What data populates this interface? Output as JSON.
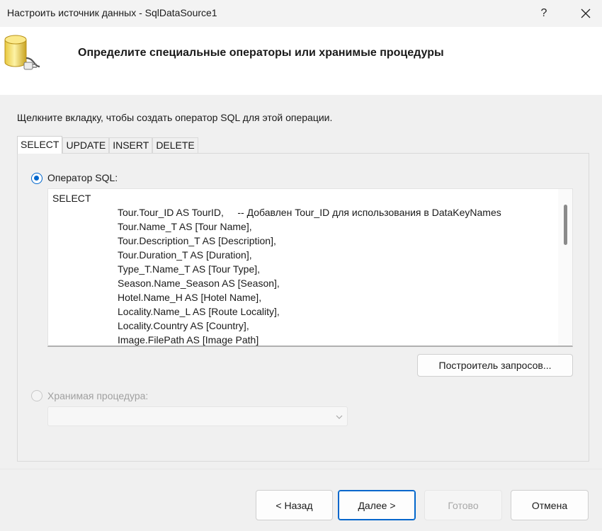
{
  "window": {
    "title": "Настроить источник данных - SqlDataSource1",
    "help_label": "?"
  },
  "header": {
    "title": "Определите специальные операторы или хранимые процедуры",
    "icon": "database-connect-icon"
  },
  "instruction": "Щелкните вкладку, чтобы создать оператор SQL для этой операции.",
  "tabs": [
    {
      "label": "SELECT",
      "active": true
    },
    {
      "label": "UPDATE",
      "active": false
    },
    {
      "label": "INSERT",
      "active": false
    },
    {
      "label": "DELETE",
      "active": false
    }
  ],
  "sql_statement": {
    "label": "Оператор SQL:",
    "selected": true,
    "lines": [
      "SELECT",
      "Tour.Tour_ID AS TourID,     -- Добавлен Tour_ID для использования в DataKeyNames",
      "Tour.Name_T AS [Tour Name],",
      "Tour.Description_T AS [Description],",
      "Tour.Duration_T AS [Duration],",
      "Type_T.Name_T AS [Tour Type],",
      "Season.Name_Season AS [Season],",
      "Hotel.Name_H AS [Hotel Name],",
      "Locality.Name_L AS [Route Locality],",
      "Locality.Country AS [Country],",
      "Image.FilePath AS [Image Path]"
    ]
  },
  "query_builder_button": "Построитель запросов...",
  "stored_procedure": {
    "label": "Хранимая процедура:",
    "selected": false,
    "value": ""
  },
  "footer": {
    "back": "< Назад",
    "next": "Далее >",
    "finish": "Готово",
    "cancel": "Отмена"
  },
  "colors": {
    "accent": "#0066cc",
    "disabled_text": "#a0a0a0"
  }
}
